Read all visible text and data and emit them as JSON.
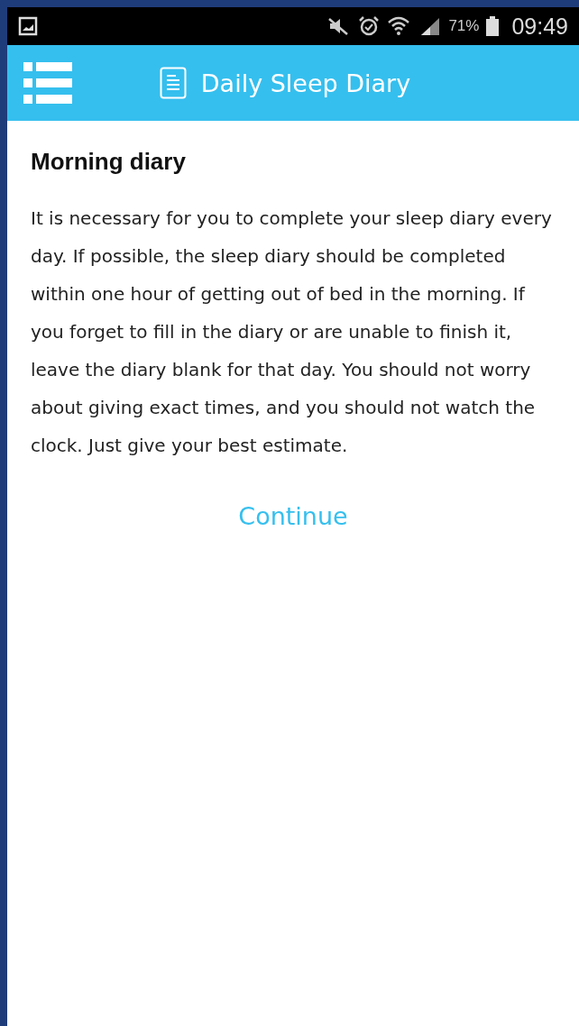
{
  "status_bar": {
    "battery": "71%",
    "time": "09:49"
  },
  "app_bar": {
    "title": "Daily Sleep Diary"
  },
  "content": {
    "heading": "Morning diary",
    "body": "It is necessary for you to complete your sleep diary every day. If possible, the sleep diary should be completed within one hour of getting out of bed in the morning. If you forget to fill in the diary or are unable to finish it, leave the diary blank for that day. You should not worry about giving exact times, and you should not watch the clock. Just give your best estimate.",
    "button": "Continue"
  }
}
